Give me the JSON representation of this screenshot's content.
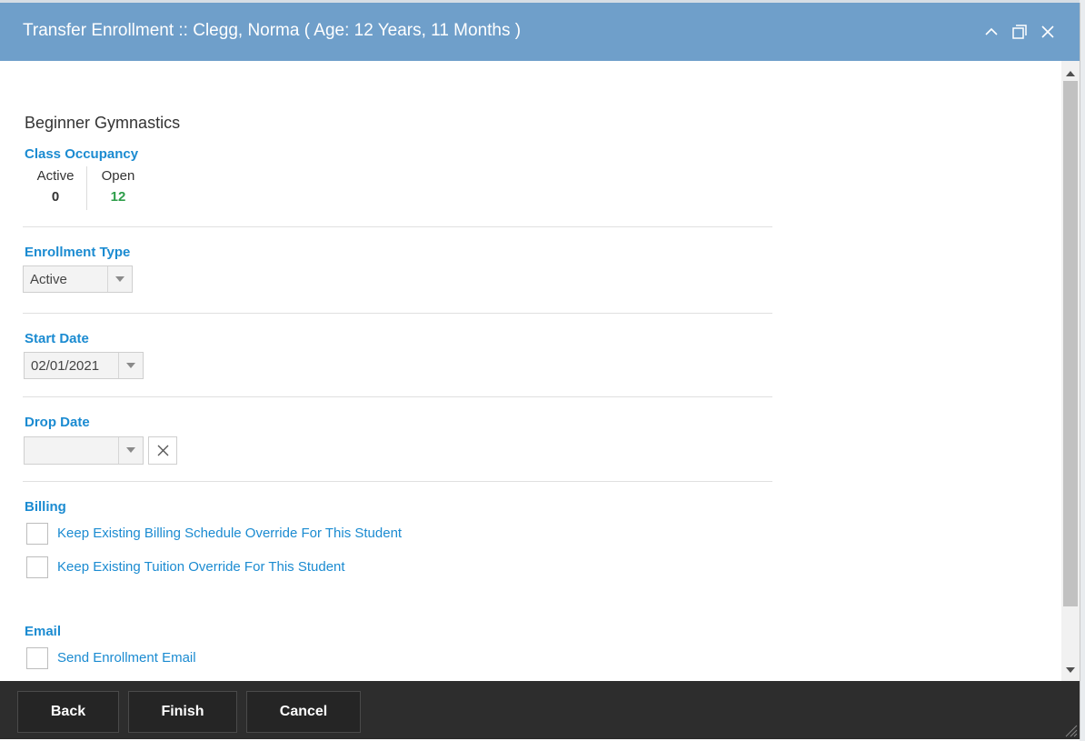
{
  "window": {
    "title": "Transfer Enrollment :: Clegg, Norma ( Age: 12 Years, 11 Months )",
    "controls": [
      "chevron-up-icon",
      "maximize-icon",
      "close-icon"
    ]
  },
  "class": {
    "name": "Beginner Gymnastics"
  },
  "occupancy": {
    "label": "Class Occupancy",
    "active_label": "Active",
    "active_value": "0",
    "open_label": "Open",
    "open_value": "12",
    "open_color": "#2e9e4a"
  },
  "enrollment_type": {
    "label": "Enrollment Type",
    "value": "Active"
  },
  "start_date": {
    "label": "Start Date",
    "value": "02/01/2021"
  },
  "drop_date": {
    "label": "Drop Date",
    "value": ""
  },
  "billing": {
    "label": "Billing",
    "options": [
      {
        "label": "Keep Existing Billing Schedule Override For This Student",
        "checked": false
      },
      {
        "label": "Keep Existing Tuition Override For This Student",
        "checked": false
      }
    ]
  },
  "email": {
    "label": "Email",
    "options": [
      {
        "label": "Send Enrollment Email",
        "checked": false
      }
    ]
  },
  "footer": {
    "back_label": "Back",
    "finish_label": "Finish",
    "cancel_label": "Cancel"
  },
  "colors": {
    "titlebar": "#6f9fca",
    "accent": "#1b8bd1",
    "footer": "#2d2d2d"
  }
}
